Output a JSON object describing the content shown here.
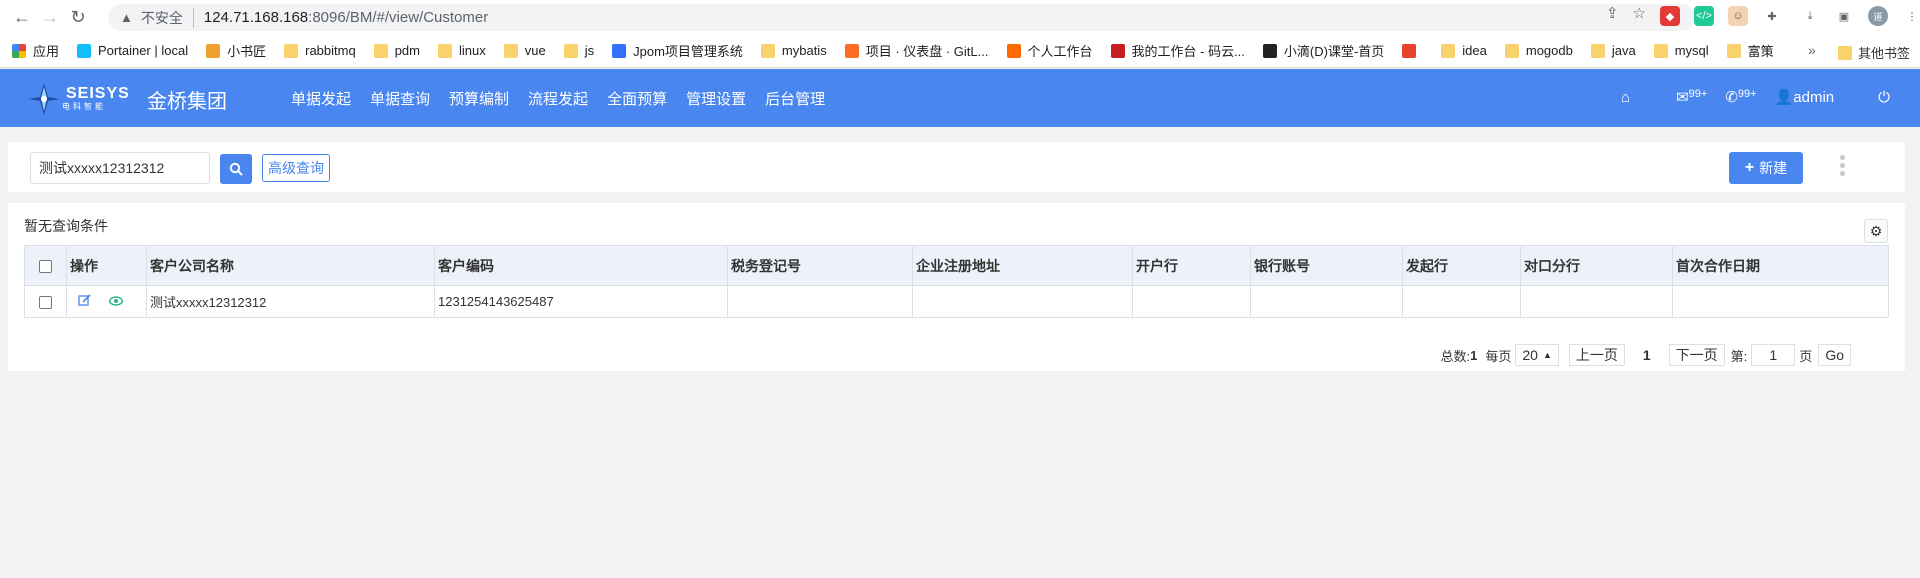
{
  "browser": {
    "insecure_label": "不安全",
    "url_host": "124.71.168.168",
    "url_rest": ":8096/BM/#/view/Customer",
    "profile_initial": "道",
    "bookmarks": [
      {
        "label": "应用",
        "icon": "apps-grid"
      },
      {
        "label": "Portainer | local",
        "icon": "portainer"
      },
      {
        "label": "小书匠",
        "icon": "xiaoshujiang"
      },
      {
        "label": "rabbitmq",
        "icon": "folder"
      },
      {
        "label": "pdm",
        "icon": "folder"
      },
      {
        "label": "linux",
        "icon": "folder"
      },
      {
        "label": "vue",
        "icon": "folder"
      },
      {
        "label": "js",
        "icon": "folder"
      },
      {
        "label": "Jpom项目管理系统",
        "icon": "jpom"
      },
      {
        "label": "mybatis",
        "icon": "folder"
      },
      {
        "label": "项目 · 仪表盘 · GitL...",
        "icon": "gitlab"
      },
      {
        "label": "个人工作台",
        "icon": "workbench"
      },
      {
        "label": "我的工作台 - 码云...",
        "icon": "gitee"
      },
      {
        "label": "小滴(D)课堂-首页",
        "icon": "xiaodi"
      },
      {
        "label": "",
        "icon": "c-red"
      },
      {
        "label": "idea",
        "icon": "folder"
      },
      {
        "label": "mogodb",
        "icon": "folder"
      },
      {
        "label": "java",
        "icon": "folder"
      },
      {
        "label": "mysql",
        "icon": "folder"
      },
      {
        "label": "富策",
        "icon": "folder"
      }
    ],
    "more_label": "»",
    "other_bookmarks": "其他书签"
  },
  "header": {
    "logo_text": "SEISYS",
    "logo_sub": "电科智能",
    "brand": "金桥集团",
    "nav": [
      "单据发起",
      "单据查询",
      "预算编制",
      "流程发起",
      "全面预算",
      "管理设置",
      "后台管理"
    ],
    "mail_badge": "99+",
    "msg_badge": "99+",
    "user": "admin"
  },
  "search": {
    "value": "测试xxxxx12312312",
    "advanced_label": "高级查询",
    "new_label": "新建"
  },
  "table": {
    "condition_text": "暂无查询条件",
    "columns": [
      "操作",
      "客户公司名称",
      "客户编码",
      "税务登记号",
      "企业注册地址",
      "开户行",
      "银行账号",
      "发起行",
      "对口分行",
      "首次合作日期"
    ],
    "rows": [
      {
        "name": "测试xxxxx12312312",
        "code": "1231254143625487",
        "tax": "",
        "addr": "",
        "bank": "",
        "account": "",
        "issuer": "",
        "branch": "",
        "date": ""
      }
    ]
  },
  "pager": {
    "total_label": "总数:",
    "total": "1",
    "per_page_label": "每页",
    "per_page": "20",
    "prev": "上一页",
    "current": "1",
    "next": "下一页",
    "goto_label": "第:",
    "goto_value": "1",
    "page_suffix": "页",
    "go": "Go"
  },
  "colors": {
    "primary": "#4a86f0",
    "header_bg": "#4a86f0",
    "th_bg": "#edf2fa"
  }
}
